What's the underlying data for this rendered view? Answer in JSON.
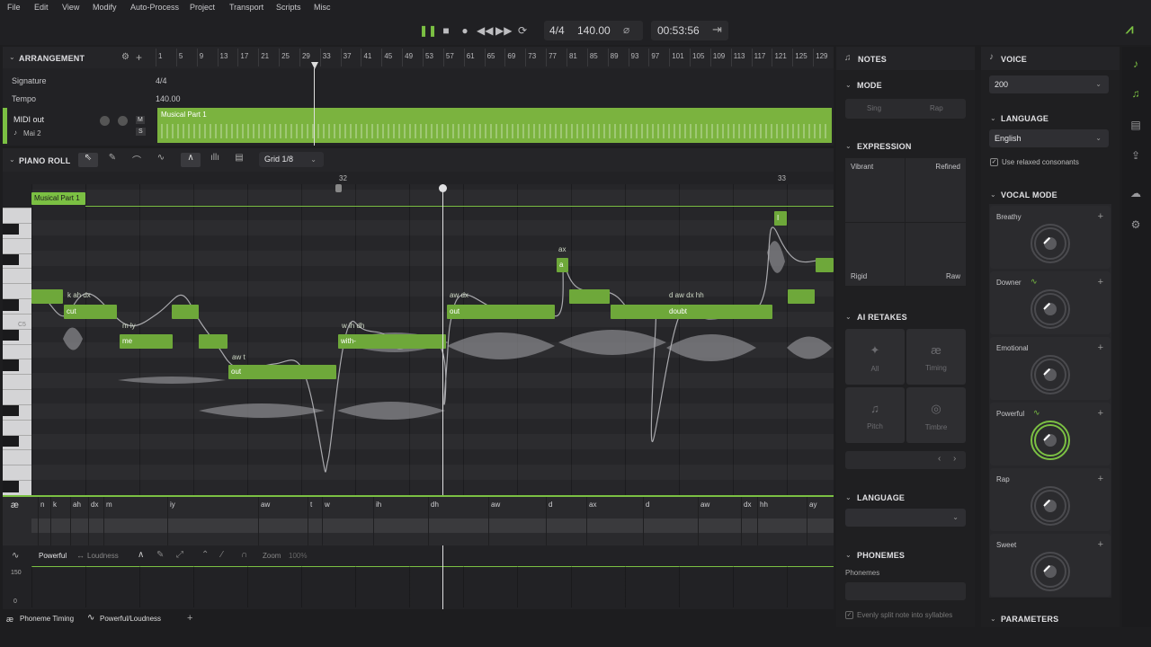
{
  "menu": [
    "File",
    "Edit",
    "View",
    "Modify",
    "Auto-Process",
    "Project",
    "Transport",
    "Scripts",
    "Misc"
  ],
  "transport": {
    "time_signature": "4/4",
    "tempo": "140.00",
    "time": "00:53:56"
  },
  "arrangement": {
    "title": "ARRANGEMENT",
    "bars": [
      "1",
      "5",
      "9",
      "13",
      "17",
      "21",
      "25",
      "29",
      "33",
      "37",
      "41",
      "45",
      "49",
      "53",
      "57",
      "61",
      "65",
      "69",
      "73",
      "77",
      "81",
      "85",
      "89",
      "93",
      "97",
      "101",
      "105",
      "109",
      "113",
      "117",
      "121",
      "125",
      "129"
    ],
    "signature_label": "Signature",
    "signature_value": "4/4",
    "tempo_label": "Tempo",
    "tempo_value": "140.00",
    "track_name": "MIDI out",
    "track_voice": "Mai 2",
    "mute": "M",
    "solo": "S",
    "part_name": "Musical Part 1"
  },
  "piano_roll": {
    "title": "PIANO ROLL",
    "grid": "Grid 1/8",
    "bar_a": "32",
    "bar_b": "33",
    "part_label": "Musical Part 1",
    "c5": "C5",
    "notes": [
      {
        "text": "cut",
        "label": "k ah dx"
      },
      {
        "text": "me",
        "label": "m ly"
      },
      {
        "text": "out",
        "label": "aw t"
      },
      {
        "text": "with-",
        "label": "w ih dh"
      },
      {
        "text": "out",
        "label": "aw dx"
      },
      {
        "text": "a",
        "label": "ax"
      },
      {
        "text": "doubt",
        "label": "d aw dx hh"
      },
      {
        "text": "I",
        "label": ""
      }
    ],
    "phoneme_icon": "æ",
    "phonemes": [
      "n",
      "k",
      "ah",
      "dx",
      "m",
      "iy",
      "aw",
      "t",
      "w",
      "ih",
      "dh",
      "aw",
      "d",
      "ax",
      "d",
      "aw",
      "dx",
      "hh",
      "ay"
    ]
  },
  "param_lane": {
    "mode": "Powerful",
    "alt": "Loudness",
    "zoom_label": "Zoom",
    "zoom": "100%",
    "y_top": "150",
    "y_bottom": "0"
  },
  "bottom_tabs": {
    "tab1": "Phoneme Timing",
    "tab2": "Powerful/Loudness",
    "add": "+"
  },
  "notes_panel": {
    "title": "NOTES",
    "mode": {
      "title": "MODE",
      "sing": "Sing",
      "rap": "Rap"
    },
    "expression": {
      "title": "EXPRESSION",
      "tl": "Vibrant",
      "tr": "Refined",
      "bl": "Rigid",
      "br": "Raw"
    },
    "retakes": {
      "title": "AI RETAKES",
      "all": "All",
      "timing": "Timing",
      "pitch": "Pitch",
      "timbre": "Timbre"
    },
    "language": {
      "title": "LANGUAGE"
    },
    "phonemes": {
      "title": "PHONEMES",
      "label": "Phonemes",
      "split": "Evenly split note into syllables"
    }
  },
  "voice_panel": {
    "title": "VOICE",
    "voice": "200",
    "language_title": "LANGUAGE",
    "language": "English",
    "relaxed": "Use relaxed consonants",
    "vocal_mode_title": "VOCAL MODE",
    "modes": [
      "Breathy",
      "Downer",
      "Emotional",
      "Powerful",
      "Rap",
      "Sweet"
    ],
    "parameters_title": "PARAMETERS"
  },
  "colors": {
    "accent": "#7bc043",
    "note": "#6ea83a",
    "bg": "#1d1d1f"
  }
}
